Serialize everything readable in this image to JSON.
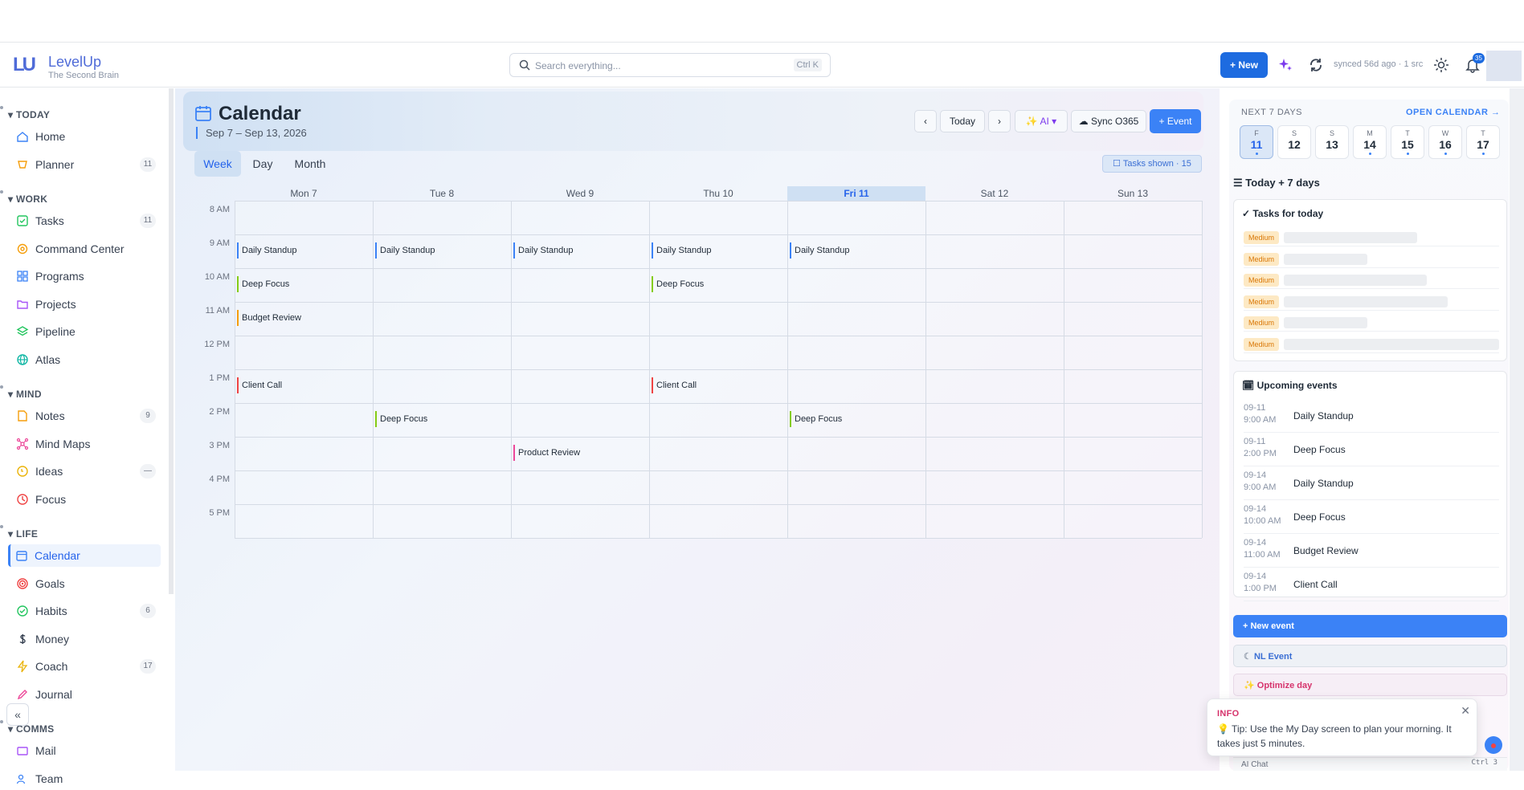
{
  "app": {
    "name": "LevelUp",
    "subtitle": "The Second Brain"
  },
  "header": {
    "search_placeholder": "Search everything...",
    "search_shortcut": "Ctrl K",
    "new_label": "+ New",
    "synced_text": "synced 56d ago · 1 src",
    "notification_count": "35"
  },
  "sidebar": {
    "sections": [
      {
        "title": "TODAY",
        "items": [
          {
            "label": "Home",
            "icon": "home-icon"
          },
          {
            "label": "Planner",
            "icon": "planner-icon",
            "count": "11"
          }
        ]
      },
      {
        "title": "WORK",
        "items": [
          {
            "label": "Tasks",
            "icon": "tasks-icon",
            "count": "11"
          },
          {
            "label": "Command Center",
            "icon": "command-icon"
          },
          {
            "label": "Programs",
            "icon": "programs-icon"
          },
          {
            "label": "Projects",
            "icon": "folder-icon"
          },
          {
            "label": "Pipeline",
            "icon": "layers-icon"
          },
          {
            "label": "Atlas",
            "icon": "globe-icon"
          }
        ]
      },
      {
        "title": "MIND",
        "items": [
          {
            "label": "Notes",
            "icon": "note-icon",
            "count": "9"
          },
          {
            "label": "Mind Maps",
            "icon": "mindmap-icon"
          },
          {
            "label": "Ideas",
            "icon": "bulb-icon",
            "count": "—"
          },
          {
            "label": "Focus",
            "icon": "clock-icon"
          }
        ]
      },
      {
        "title": "LIFE",
        "items": [
          {
            "label": "Calendar",
            "icon": "calendar-icon"
          },
          {
            "label": "Goals",
            "icon": "target-icon"
          },
          {
            "label": "Habits",
            "icon": "check-circle-icon",
            "count": "6"
          },
          {
            "label": "Money",
            "icon": "dollar-icon"
          },
          {
            "label": "Coach",
            "icon": "bolt-icon",
            "count": "17"
          },
          {
            "label": "Journal",
            "icon": "pen-icon"
          }
        ]
      },
      {
        "title": "COMMS",
        "items": [
          {
            "label": "Mail",
            "icon": "mail-icon"
          },
          {
            "label": "Team",
            "icon": "team-icon"
          }
        ]
      }
    ],
    "collapse_label": "«"
  },
  "calendar": {
    "title": "Calendar",
    "range": "Sep 7 – Sep 13, 2026",
    "prev": "‹",
    "today": "Today",
    "next": "›",
    "ai": "AI",
    "sync": "Sync O365",
    "add_event": "+ Event",
    "tasks_shown": "Tasks shown · 15",
    "views": [
      "Week",
      "Day",
      "Month"
    ],
    "days": [
      "Mon 7",
      "Tue 8",
      "Wed 9",
      "Thu 10",
      "Fri 11",
      "Sat 12",
      "Sun 13"
    ],
    "hours": [
      "8 AM",
      "9 AM",
      "10 AM",
      "11 AM",
      "12 PM",
      "1 PM",
      "2 PM",
      "3 PM",
      "4 PM",
      "5 PM"
    ],
    "events": [
      {
        "day": 0,
        "hour": 1,
        "title": "Daily Standup",
        "color": "#3b82f6"
      },
      {
        "day": 1,
        "hour": 1,
        "title": "Daily Standup",
        "color": "#3b82f6"
      },
      {
        "day": 2,
        "hour": 1,
        "title": "Daily Standup",
        "color": "#3b82f6"
      },
      {
        "day": 3,
        "hour": 1,
        "title": "Daily Standup",
        "color": "#3b82f6"
      },
      {
        "day": 4,
        "hour": 1,
        "title": "Daily Standup",
        "color": "#3b82f6"
      },
      {
        "day": 0,
        "hour": 2,
        "title": "Deep Focus",
        "color": "#84cc16"
      },
      {
        "day": 3,
        "hour": 2,
        "title": "Deep Focus",
        "color": "#84cc16"
      },
      {
        "day": 0,
        "hour": 3,
        "title": "Budget Review",
        "color": "#f59e0b"
      },
      {
        "day": 0,
        "hour": 5,
        "title": "Client Call",
        "color": "#ef4444"
      },
      {
        "day": 3,
        "hour": 5,
        "title": "Client Call",
        "color": "#ef4444"
      },
      {
        "day": 1,
        "hour": 6,
        "title": "Deep Focus",
        "color": "#84cc16"
      },
      {
        "day": 4,
        "hour": 6,
        "title": "Deep Focus",
        "color": "#84cc16"
      },
      {
        "day": 2,
        "hour": 7,
        "title": "Product Review",
        "color": "#ec4899"
      }
    ]
  },
  "right_panel": {
    "next7_title": "NEXT 7 DAYS",
    "open_calendar": "OPEN CALENDAR →",
    "days": [
      {
        "letter": "F",
        "num": "11"
      },
      {
        "letter": "S",
        "num": "12"
      },
      {
        "letter": "S",
        "num": "13"
      },
      {
        "letter": "M",
        "num": "14"
      },
      {
        "letter": "T",
        "num": "15"
      },
      {
        "letter": "W",
        "num": "16"
      },
      {
        "letter": "T",
        "num": "17"
      }
    ],
    "today7_title": "Today + 7 days",
    "tasks_title": "✓ Tasks for today",
    "task_priority": "Medium",
    "upcoming_title": "Upcoming events",
    "upcoming": [
      {
        "date": "09-11",
        "time": "9:00 AM",
        "title": "Daily Standup"
      },
      {
        "date": "09-11",
        "time": "2:00 PM",
        "title": "Deep Focus"
      },
      {
        "date": "09-14",
        "time": "9:00 AM",
        "title": "Daily Standup"
      },
      {
        "date": "09-14",
        "time": "10:00 AM",
        "title": "Deep Focus"
      },
      {
        "date": "09-14",
        "time": "11:00 AM",
        "title": "Budget Review"
      },
      {
        "date": "09-14",
        "time": "1:00 PM",
        "title": "Client Call"
      }
    ],
    "new_event": "+ New event",
    "nl_event": "NL Event",
    "optimize_day": "Optimize day",
    "ai_chat": "AI Chat",
    "ai_chat_key": "Ctrl 3"
  },
  "toast": {
    "title": "INFO",
    "message": "💡 Tip: Use the My Day screen to plan your morning. It takes just 5 minutes.",
    "close": "✕"
  }
}
